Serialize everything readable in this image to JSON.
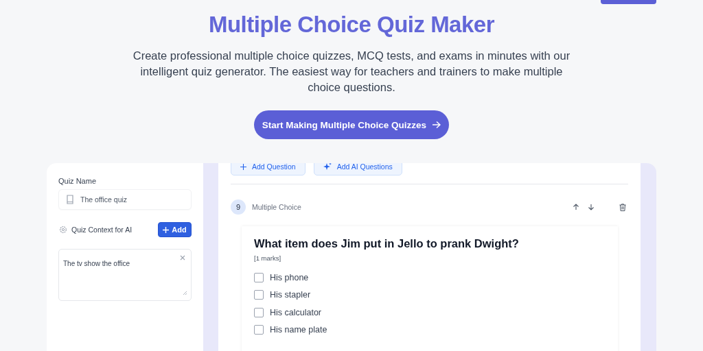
{
  "hero": {
    "title": "Multiple Choice Quiz Maker",
    "subtitle": "Create professional multiple choice quizzes, MCQ tests, and exams in minutes with our intelligent quiz generator. The easiest way for teachers and trainers to make multiple choice questions.",
    "cta": "Start Making Multiple Choice Quizzes"
  },
  "sidebar": {
    "name_label": "Quiz Name",
    "name_value": "The office quiz",
    "context_label": "Quiz Context for AI",
    "add_button": "Add",
    "context_value": "The tv show the office"
  },
  "toolbar": [
    "Add Question",
    "Add AI Questions"
  ],
  "question": {
    "number": "9",
    "type": "Multiple Choice",
    "text": "What item does Jim put in Jello to prank Dwight?",
    "marks": "[1 marks]",
    "options": [
      {
        "label": "His phone",
        "checked": false
      },
      {
        "label": "His stapler",
        "checked": false
      },
      {
        "label": "His calculator",
        "checked": false
      },
      {
        "label": "His name plate",
        "checked": false
      }
    ]
  }
}
